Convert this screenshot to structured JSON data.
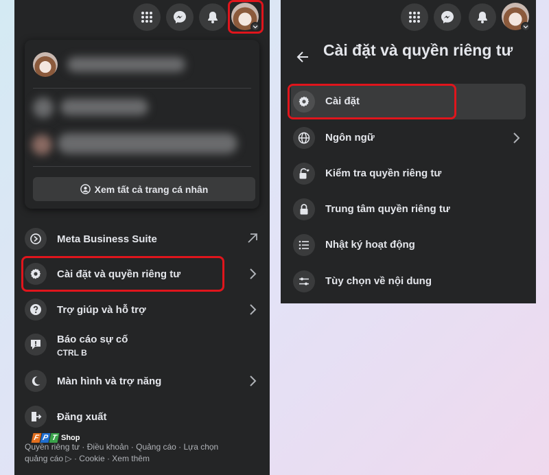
{
  "left_panel": {
    "see_all_profiles": "Xem tất cả trang cá nhân",
    "menu": [
      {
        "label": "Meta Business Suite",
        "icon": "meta-business-icon",
        "trail": "external-arrow-icon"
      },
      {
        "label": "Cài đặt và quyền riêng tư",
        "icon": "gear-icon",
        "trail": "chevron-right-icon"
      },
      {
        "label": "Trợ giúp và hỗ trợ",
        "icon": "help-icon",
        "trail": "chevron-right-icon"
      },
      {
        "label": "Báo cáo sự cố",
        "sub": "CTRL B",
        "icon": "report-icon"
      },
      {
        "label": "Màn hình và trợ năng",
        "icon": "moon-icon",
        "trail": "chevron-right-icon"
      },
      {
        "label": "Đăng xuất",
        "icon": "logout-icon"
      }
    ],
    "footer_line1": "Quyền riêng tư · Điều khoản · Quảng cáo · Lựa chọn",
    "footer_line2": "quảng cáo ▷ · Cookie · Xem thêm"
  },
  "watermark": {
    "letters": [
      "F",
      "P",
      "T"
    ],
    "shop": "Shop",
    "colors": [
      "#e36f1e",
      "#1f6fd1",
      "#3aa34a"
    ]
  },
  "right_panel": {
    "title": "Cài đặt và quyền riêng tư",
    "items": [
      {
        "label": "Cài đặt",
        "icon": "gear-icon"
      },
      {
        "label": "Ngôn ngữ",
        "icon": "globe-icon",
        "trail": "chevron-right-icon"
      },
      {
        "label": "Kiểm tra quyền riêng tư",
        "icon": "lock-heart-icon"
      },
      {
        "label": "Trung tâm quyền riêng tư",
        "icon": "lock-icon"
      },
      {
        "label": "Nhật ký hoạt động",
        "icon": "list-icon"
      },
      {
        "label": "Tùy chọn về nội dung",
        "icon": "sliders-icon"
      }
    ]
  },
  "colors": {
    "panel": "#242526",
    "button": "#3a3b3c",
    "text": "#e4e6eb",
    "highlight": "#e0151c"
  }
}
